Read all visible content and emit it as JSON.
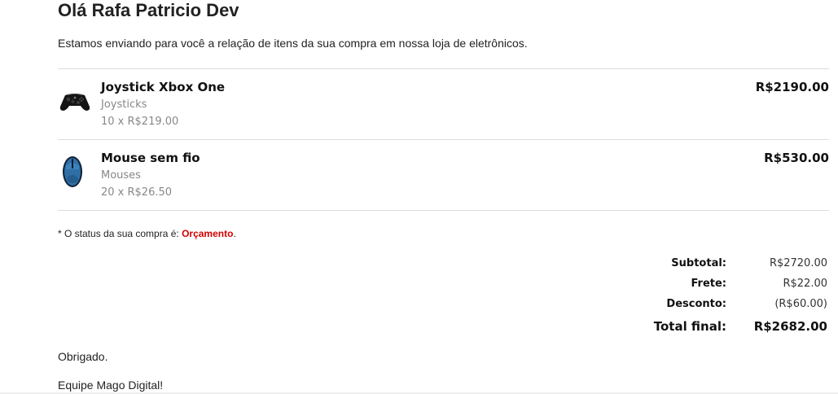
{
  "header": {
    "greeting": "Olá Rafa Patricio Dev",
    "intro": "Estamos enviando para você a relação de itens da sua compra em nossa loja de eletrônicos."
  },
  "items": [
    {
      "name": "Joystick Xbox One",
      "category": "Joysticks",
      "qty_price": "10 x R$219.00",
      "total": "R$2190.00",
      "icon": "xbox-controller-icon"
    },
    {
      "name": "Mouse sem fio",
      "category": "Mouses",
      "qty_price": "20 x R$26.50",
      "total": "R$530.00",
      "icon": "wireless-mouse-icon"
    }
  ],
  "status": {
    "prefix": "* O status da sua compra é: ",
    "value": "Orçamento",
    "suffix": ".",
    "color": "#d40000"
  },
  "totals": {
    "subtotal_label": "Subtotal:",
    "subtotal_value": "R$2720.00",
    "shipping_label": "Frete:",
    "shipping_value": "R$22.00",
    "discount_label": "Desconto:",
    "discount_value": "(R$60.00)",
    "final_label": "Total final:",
    "final_value": "R$2682.00"
  },
  "footer": {
    "thanks": "Obrigado.",
    "team": "Equipe Mago Digital!"
  }
}
